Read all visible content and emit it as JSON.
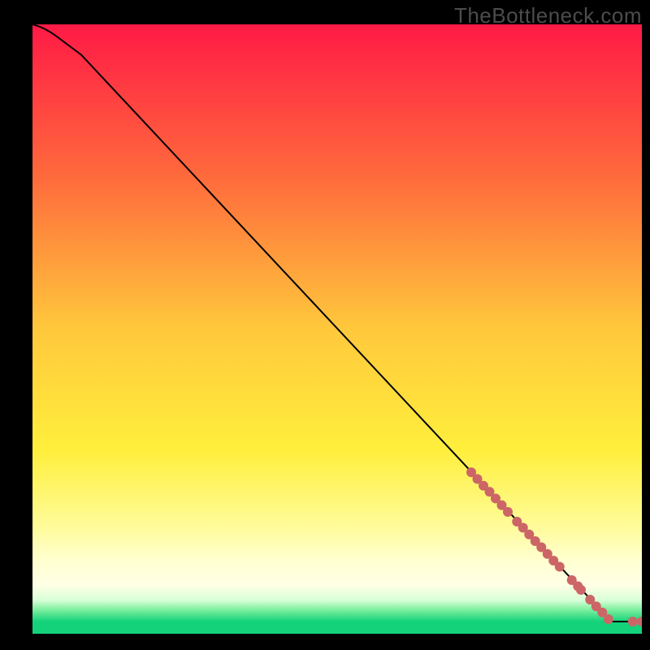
{
  "watermark": "TheBottleneck.com",
  "chart_data": {
    "type": "line",
    "title": "",
    "xlabel": "",
    "ylabel": "",
    "xlim": [
      0,
      100
    ],
    "ylim": [
      0,
      100
    ],
    "grid": false,
    "line": {
      "x": [
        0,
        4,
        8,
        95,
        100
      ],
      "y": [
        100,
        98,
        95,
        2,
        2
      ],
      "stroke": "#000000"
    },
    "markers": {
      "color": "#cc6666",
      "radius": 6,
      "points": [
        {
          "x": 72.0,
          "y": 26.5
        },
        {
          "x": 73.0,
          "y": 25.4
        },
        {
          "x": 74.0,
          "y": 24.3
        },
        {
          "x": 75.0,
          "y": 23.3
        },
        {
          "x": 76.0,
          "y": 22.2
        },
        {
          "x": 77.0,
          "y": 21.1
        },
        {
          "x": 78.0,
          "y": 20.0
        },
        {
          "x": 79.5,
          "y": 18.4
        },
        {
          "x": 80.5,
          "y": 17.4
        },
        {
          "x": 81.5,
          "y": 16.3
        },
        {
          "x": 82.5,
          "y": 15.2
        },
        {
          "x": 83.5,
          "y": 14.2
        },
        {
          "x": 84.5,
          "y": 13.1
        },
        {
          "x": 85.5,
          "y": 12.0
        },
        {
          "x": 86.5,
          "y": 11.0
        },
        {
          "x": 88.5,
          "y": 8.8
        },
        {
          "x": 89.5,
          "y": 7.8
        },
        {
          "x": 90.0,
          "y": 7.2
        },
        {
          "x": 91.5,
          "y": 5.6
        },
        {
          "x": 92.5,
          "y": 4.5
        },
        {
          "x": 93.5,
          "y": 3.5
        },
        {
          "x": 94.5,
          "y": 2.4
        },
        {
          "x": 98.5,
          "y": 2.0
        },
        {
          "x": 100.0,
          "y": 2.0
        }
      ]
    },
    "background_gradient": {
      "stops": [
        {
          "offset": 0.0,
          "color": "#ff1a46"
        },
        {
          "offset": 0.25,
          "color": "#ff6a3c"
        },
        {
          "offset": 0.5,
          "color": "#ffc83c"
        },
        {
          "offset": 0.7,
          "color": "#ffef3c"
        },
        {
          "offset": 0.82,
          "color": "#fffb96"
        },
        {
          "offset": 0.88,
          "color": "#ffffd0"
        },
        {
          "offset": 0.92,
          "color": "#ffffe6"
        },
        {
          "offset": 0.945,
          "color": "#d8ffd8"
        },
        {
          "offset": 0.96,
          "color": "#80f0a0"
        },
        {
          "offset": 0.98,
          "color": "#14d27a"
        },
        {
          "offset": 1.0,
          "color": "#14d27a"
        }
      ]
    }
  }
}
